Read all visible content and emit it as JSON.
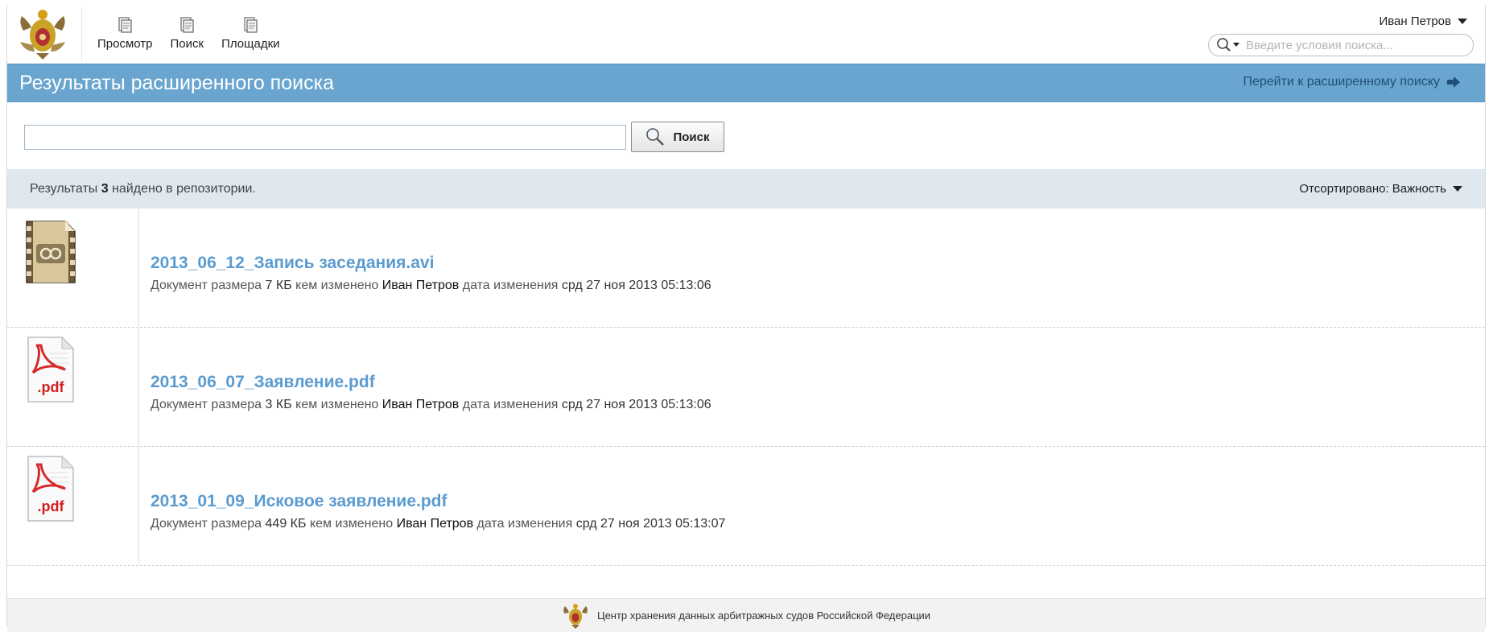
{
  "nav": [
    {
      "label": "Просмотр",
      "icon": "browse-icon"
    },
    {
      "label": "Поиск",
      "icon": "search-nav-icon"
    },
    {
      "label": "Площадки",
      "icon": "sites-icon"
    }
  ],
  "user": {
    "name": "Иван Петров"
  },
  "top_search": {
    "placeholder": "Введите условия поиска..."
  },
  "titlebar": {
    "title": "Результаты расширенного поиска",
    "advanced_link": "Перейти к расширенному поиску"
  },
  "search": {
    "value": "",
    "button_label": "Поиск"
  },
  "results_bar": {
    "prefix": "Результаты",
    "count": "3",
    "suffix": "найдено в репозитории.",
    "sort_label": "Отсортировано: Важность"
  },
  "meta_words": {
    "size_label": "Документ размера",
    "modified_by": "кем изменено",
    "modified_date": "дата изменения"
  },
  "results": [
    {
      "name": "2013_06_12_Запись заседания.avi",
      "type": "video",
      "size": "7 КБ",
      "user": "Иван Петров",
      "date": "срд 27 ноя 2013 05:13:06"
    },
    {
      "name": "2013_06_07_Заявление.pdf",
      "type": "pdf",
      "size": "3 КБ",
      "user": "Иван Петров",
      "date": "срд 27 ноя 2013 05:13:06"
    },
    {
      "name": "2013_01_09_Исковое заявление.pdf",
      "type": "pdf",
      "size": "449 КБ",
      "user": "Иван Петров",
      "date": "срд 27 ноя 2013 05:13:07"
    }
  ],
  "pdf_badge": ".pdf",
  "footer": {
    "text": "Центр хранения данных арбитражных судов Российской Федерации"
  },
  "colors": {
    "title_bar": "#6aa5cf",
    "link": "#5b9bd0",
    "results_bar": "#dfe8ef"
  }
}
